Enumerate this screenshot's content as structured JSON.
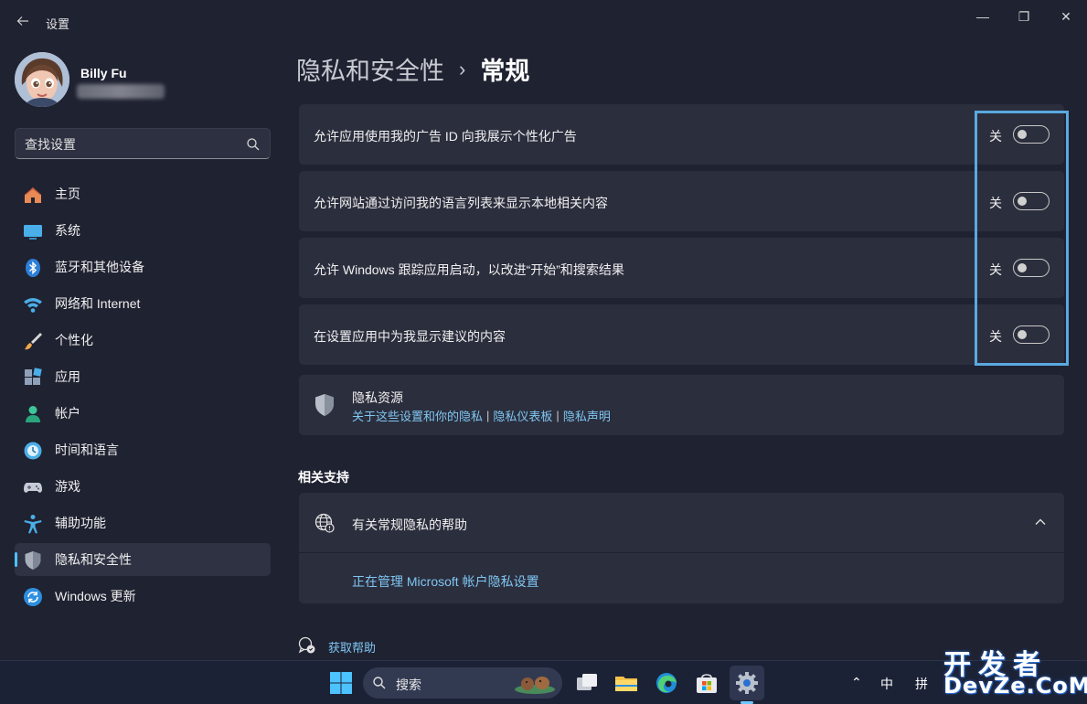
{
  "window": {
    "app_title": "设置",
    "controls": {
      "minimize": "—",
      "restore": "❐",
      "close": "✕"
    }
  },
  "user": {
    "name": "Billy Fu"
  },
  "sidebar": {
    "search_placeholder": "查找设置",
    "items": [
      {
        "label": "主页",
        "icon": "home-icon",
        "active": false
      },
      {
        "label": "系统",
        "icon": "monitor-icon",
        "active": false
      },
      {
        "label": "蓝牙和其他设备",
        "icon": "bluetooth-icon",
        "active": false
      },
      {
        "label": "网络和 Internet",
        "icon": "wifi-icon",
        "active": false
      },
      {
        "label": "个性化",
        "icon": "brush-icon",
        "active": false
      },
      {
        "label": "应用",
        "icon": "apps-icon",
        "active": false
      },
      {
        "label": "帐户",
        "icon": "person-icon",
        "active": false
      },
      {
        "label": "时间和语言",
        "icon": "clock-globe-icon",
        "active": false
      },
      {
        "label": "游戏",
        "icon": "gamepad-icon",
        "active": false
      },
      {
        "label": "辅助功能",
        "icon": "accessibility-icon",
        "active": false
      },
      {
        "label": "隐私和安全性",
        "icon": "shield-icon",
        "active": true
      },
      {
        "label": "Windows 更新",
        "icon": "update-icon",
        "active": false
      }
    ]
  },
  "breadcrumb": {
    "parent": "隐私和安全性",
    "separator": "›",
    "current": "常规"
  },
  "settings": [
    {
      "label": "允许应用使用我的广告 ID 向我展示个性化广告",
      "state": "关",
      "on": false
    },
    {
      "label": "允许网站通过访问我的语言列表来显示本地相关内容",
      "state": "关",
      "on": false
    },
    {
      "label": "允许 Windows 跟踪应用启动，以改进“开始”和搜索结果",
      "state": "关",
      "on": false
    },
    {
      "label": "在设置应用中为我显示建议的内容",
      "state": "关",
      "on": false
    }
  ],
  "privacy_resources": {
    "title": "隐私资源",
    "links": [
      "关于这些设置和你的隐私",
      "隐私仪表板",
      "隐私声明"
    ],
    "separator": "|"
  },
  "related_support": {
    "title": "相关支持",
    "help_title": "有关常规隐私的帮助",
    "help_link": "正在管理 Microsoft 帐户隐私设置"
  },
  "get_help": "获取帮助",
  "taskbar": {
    "search_label": "搜索",
    "tray_ime_1": "中",
    "tray_ime_2": "拼",
    "tray_chevron": "⌃"
  },
  "watermark": {
    "top": "开发者",
    "bottom": "DevZe.CoM"
  },
  "colors": {
    "background": "#1f2231",
    "card": "#2b2e3d",
    "accent": "#4cc2ff",
    "link": "#7fc6f2",
    "highlight_border": "#5aa9e0"
  }
}
